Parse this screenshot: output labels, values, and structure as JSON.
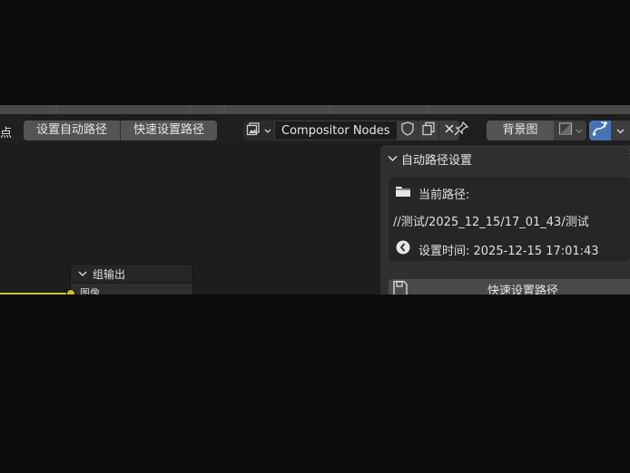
{
  "header": {
    "partial_menu_label": "点",
    "buttons": [
      "设置自动路径",
      "快速设置路径"
    ],
    "node_tree_name": "Compositor Nodes",
    "backdrop_label": "背景图"
  },
  "node": {
    "title": "组输出",
    "socket_label": "图像",
    "socket_color": "#c7c729"
  },
  "panel": {
    "title": "自动路径设置",
    "current_path_label": "当前路径:",
    "current_path_value": "//测试/2025_12_15/17_01_43/测试",
    "set_time_text": "设置时间: 2025-12-15 17:01:43",
    "quick_set_button": "快速设置路径"
  },
  "icons": {
    "node_tree_type": "image-stack-icon",
    "fake_user": "shield-icon",
    "duplicate": "duplicate-icon",
    "unlink": "close-icon",
    "pin": "pin-icon",
    "backdrop_mode": "image-channels-icon",
    "active_tool": "curve-tool-icon",
    "folder": "folder-icon",
    "clock": "clock-icon",
    "save": "save-icon"
  },
  "colors": {
    "accent": "#4772b3",
    "link": "#c7c729"
  }
}
